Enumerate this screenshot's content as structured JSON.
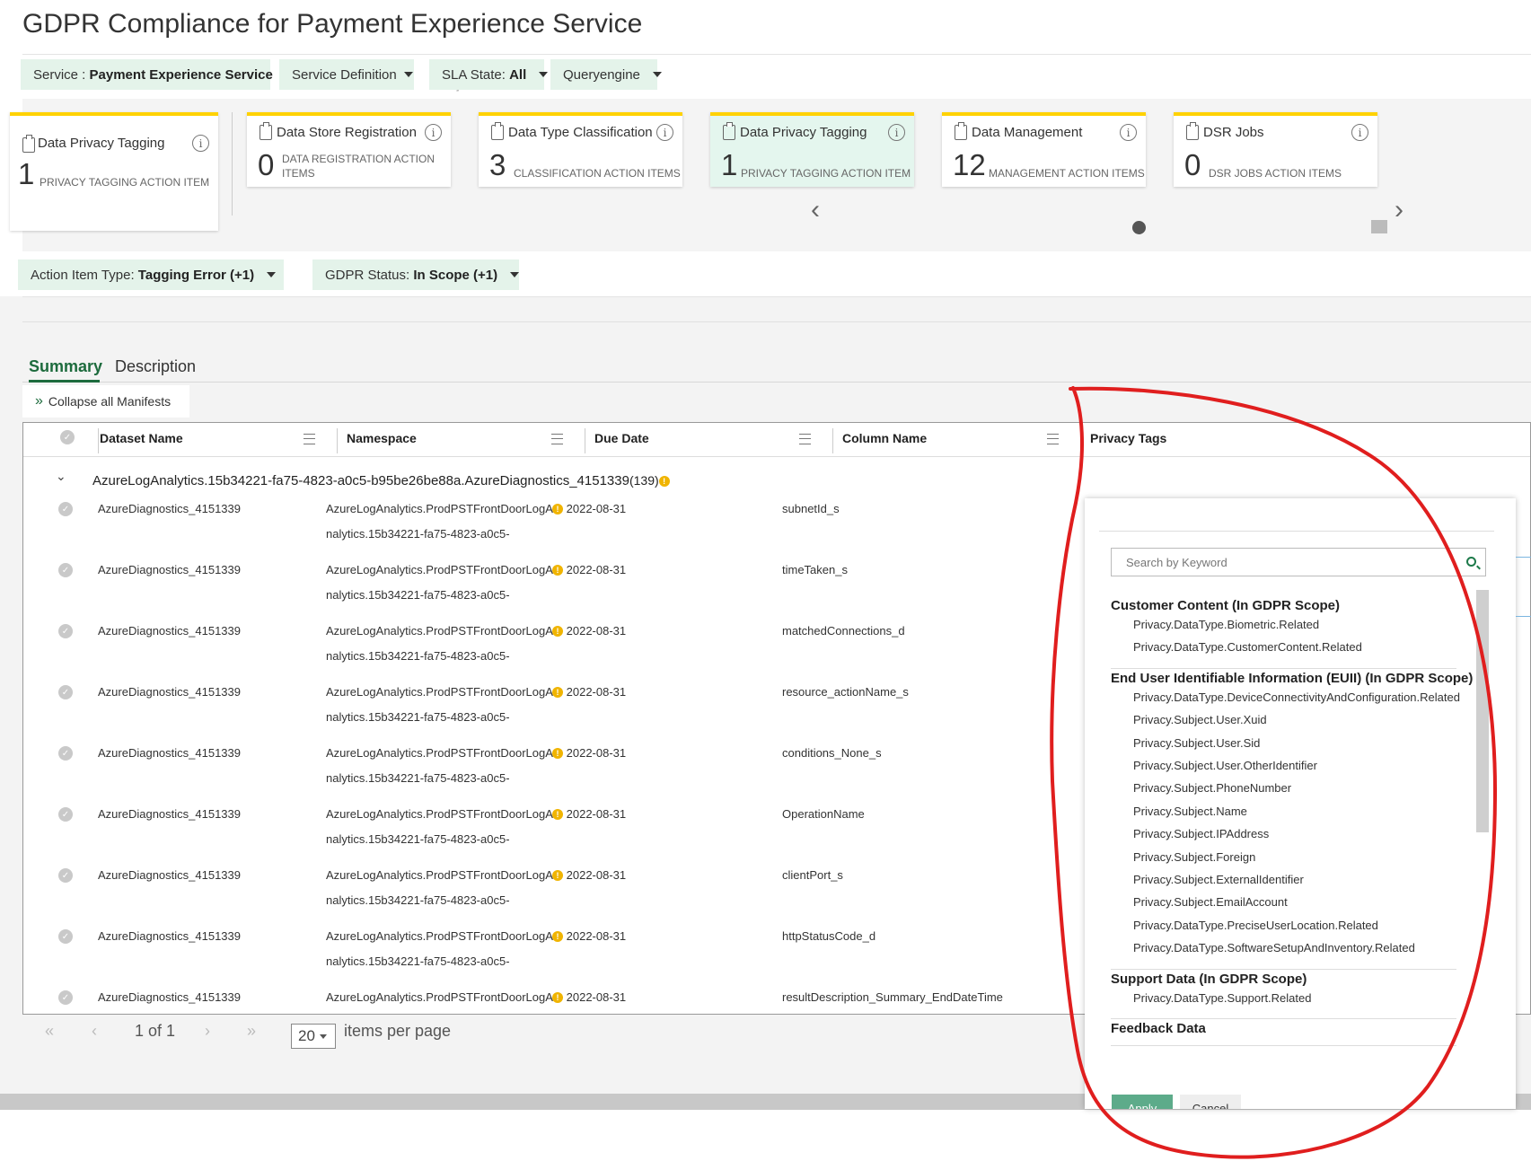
{
  "page_title": "GDPR Compliance for Payment Experience Service",
  "filters": {
    "service_prefix": "Service : ",
    "service_value": "Payment Experience Service",
    "service_definition": "Service Definition",
    "sla_prefix": "SLA State: ",
    "sla_value": "All",
    "queryengine": "Queryengine"
  },
  "selected_tile": {
    "title": "Data Privacy Tagging",
    "count": "1",
    "label": "PRIVACY TAGGING ACTION ITEM"
  },
  "tiles": [
    {
      "title": "Data Store Registration",
      "count": "0",
      "label": "DATA REGISTRATION ACTION ITEMS"
    },
    {
      "title": "Data Type Classification",
      "count": "3",
      "label": "CLASSIFICATION ACTION ITEMS"
    },
    {
      "title": "Data Privacy Tagging",
      "count": "1",
      "label": "PRIVACY TAGGING ACTION ITEM"
    },
    {
      "title": "Data Management",
      "count": "12",
      "label": "MANAGEMENT ACTION ITEMS"
    },
    {
      "title": "DSR Jobs",
      "count": "0",
      "label": "DSR JOBS ACTION ITEMS"
    }
  ],
  "action_filters": {
    "type_prefix": "Action Item Type: ",
    "type_value": "Tagging Error (+1)",
    "status_prefix": "GDPR Status: ",
    "status_value": "In Scope (+1)"
  },
  "tabs": {
    "summary": "Summary",
    "description": "Description"
  },
  "collapse_label": "Collapse all Manifests",
  "columns": {
    "dataset": "Dataset Name",
    "namespace": "Namespace",
    "due": "Due Date",
    "column": "Column Name",
    "tags": "Privacy Tags"
  },
  "group": {
    "name": "AzureLogAnalytics.15b34221-fa75-4823-a0c5-b95be26be88a.AzureDiagnostics_4151339",
    "count": "(139)"
  },
  "rows": [
    {
      "dataset": "AzureDiagnostics_4151339",
      "ns1": "AzureLogAnalytics.ProdPSTFrontDoorLogA",
      "ns2": "nalytics.15b34221-fa75-4823-a0c5-",
      "due": "2022-08-31",
      "column": "subnetId_s"
    },
    {
      "dataset": "AzureDiagnostics_4151339",
      "ns1": "AzureLogAnalytics.ProdPSTFrontDoorLogA",
      "ns2": "nalytics.15b34221-fa75-4823-a0c5-",
      "due": "2022-08-31",
      "column": "timeTaken_s"
    },
    {
      "dataset": "AzureDiagnostics_4151339",
      "ns1": "AzureLogAnalytics.ProdPSTFrontDoorLogA",
      "ns2": "nalytics.15b34221-fa75-4823-a0c5-",
      "due": "2022-08-31",
      "column": "matchedConnections_d"
    },
    {
      "dataset": "AzureDiagnostics_4151339",
      "ns1": "AzureLogAnalytics.ProdPSTFrontDoorLogA",
      "ns2": "nalytics.15b34221-fa75-4823-a0c5-",
      "due": "2022-08-31",
      "column": "resource_actionName_s"
    },
    {
      "dataset": "AzureDiagnostics_4151339",
      "ns1": "AzureLogAnalytics.ProdPSTFrontDoorLogA",
      "ns2": "nalytics.15b34221-fa75-4823-a0c5-",
      "due": "2022-08-31",
      "column": "conditions_None_s"
    },
    {
      "dataset": "AzureDiagnostics_4151339",
      "ns1": "AzureLogAnalytics.ProdPSTFrontDoorLogA",
      "ns2": "nalytics.15b34221-fa75-4823-a0c5-",
      "due": "2022-08-31",
      "column": "OperationName"
    },
    {
      "dataset": "AzureDiagnostics_4151339",
      "ns1": "AzureLogAnalytics.ProdPSTFrontDoorLogA",
      "ns2": "nalytics.15b34221-fa75-4823-a0c5-",
      "due": "2022-08-31",
      "column": "clientPort_s"
    },
    {
      "dataset": "AzureDiagnostics_4151339",
      "ns1": "AzureLogAnalytics.ProdPSTFrontDoorLogA",
      "ns2": "nalytics.15b34221-fa75-4823-a0c5-",
      "due": "2022-08-31",
      "column": "httpStatusCode_d"
    },
    {
      "dataset": "AzureDiagnostics_4151339",
      "ns1": "AzureLogAnalytics.ProdPSTFrontDoorLogA",
      "ns2": "",
      "due": "2022-08-31",
      "column": "resultDescription_Summary_EndDateTime"
    }
  ],
  "pager": {
    "first": "«",
    "prev": "‹",
    "page": "1 of 1",
    "next": "›",
    "last": "»",
    "page_size": "20",
    "per_page": "items per page"
  },
  "tag_panel": {
    "search_placeholder": "Search by Keyword",
    "categories": [
      {
        "title": "Customer Content (In GDPR Scope)",
        "tags": [
          "Privacy.DataType.Biometric.Related",
          "Privacy.DataType.CustomerContent.Related"
        ]
      },
      {
        "title": "End User Identifiable Information (EUII) (In GDPR Scope)",
        "tags": [
          "Privacy.DataType.DeviceConnectivityAndConfiguration.Related",
          "Privacy.Subject.User.Xuid",
          "Privacy.Subject.User.Sid",
          "Privacy.Subject.User.OtherIdentifier",
          "Privacy.Subject.PhoneNumber",
          "Privacy.Subject.Name",
          "Privacy.Subject.IPAddress",
          "Privacy.Subject.Foreign",
          "Privacy.Subject.ExternalIdentifier",
          "Privacy.Subject.EmailAccount",
          "Privacy.DataType.PreciseUserLocation.Related",
          "Privacy.DataType.SoftwareSetupAndInventory.Related"
        ]
      },
      {
        "title": "Support Data (In GDPR Scope)",
        "tags": [
          "Privacy.DataType.Support.Related"
        ]
      },
      {
        "title": "Feedback Data",
        "tags": []
      }
    ],
    "apply": "Apply",
    "cancel": "Cancel"
  },
  "colors": {
    "accent_green": "#1d6b3d",
    "chip_bg": "#e4f3ea",
    "tile_highlight": "#ffd200",
    "warning": "#f0b400",
    "annotation": "#e01e1e"
  },
  "icons": [
    "document-icon",
    "info-icon",
    "chevron-left-icon",
    "chevron-right-icon",
    "carousel-dot-icon",
    "double-chevron-icon",
    "check-circle-icon",
    "column-menu-icon",
    "warning-icon",
    "search-icon"
  ]
}
